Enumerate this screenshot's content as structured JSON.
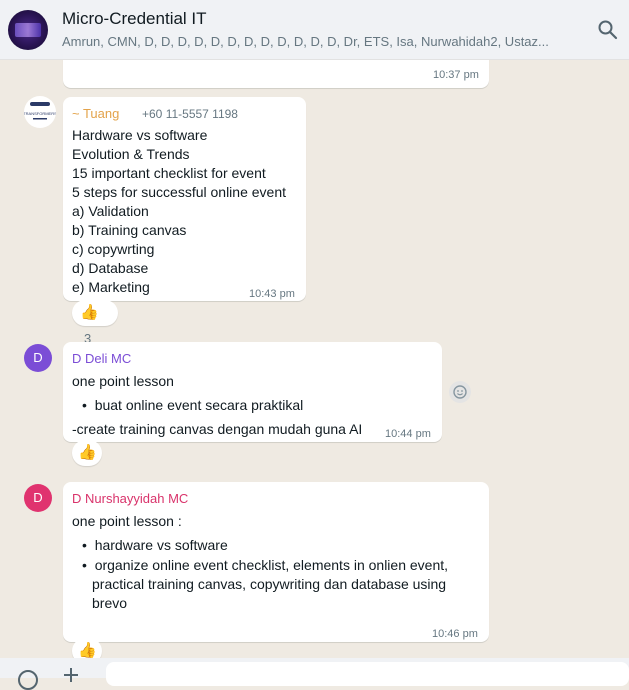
{
  "header": {
    "title": "Micro-Credential IT",
    "members": "Amrun, CMN, D, D, D, D, D, D, D, D, D, D, D, D, Dr, ETS, Isa, Nurwahidah2, Ustaz..."
  },
  "messages": [
    {
      "time": "10:37 pm"
    },
    {
      "sender": "~ Tuang",
      "phone": "+60 11-5557 1198",
      "lines": [
        "Hardware vs software",
        "Evolution & Trends",
        "15 important checklist for event",
        "5 steps for successful online event",
        "a) Validation",
        "b) Training canvas",
        "c) copywrting",
        "d) Database",
        "e) Marketing"
      ],
      "time": "10:43 pm",
      "reaction_emoji": "👍",
      "reaction_count": "3"
    },
    {
      "avatar_letter": "D",
      "sender": "D Deli MC",
      "line1": "one point lesson",
      "bullet1": "buat online event secara praktikal",
      "line2": "-create training canvas dengan mudah guna AI",
      "time": "10:44 pm",
      "reaction_emoji": "👍"
    },
    {
      "avatar_letter": "D",
      "sender": "D Nurshayyidah MC",
      "line1": "one point lesson :",
      "bullet1": "hardware vs software",
      "bullet2_lines": [
        "organize online event checklist, elements in onlien event,",
        "practical training canvas, copywriting dan database using",
        "brevo"
      ],
      "time": "10:46 pm",
      "reaction_emoji": "👍"
    }
  ],
  "colors": {
    "tuang_sender": "#e3a34b",
    "deli_sender": "#7b4dd6",
    "deli_avatar": "#7b4dd6",
    "nur_sender": "#d9336b",
    "nur_avatar": "#e0336f"
  },
  "icons": {
    "search": "search-icon",
    "react": "emoji-react-icon",
    "logo": "tuang-logo-icon"
  }
}
